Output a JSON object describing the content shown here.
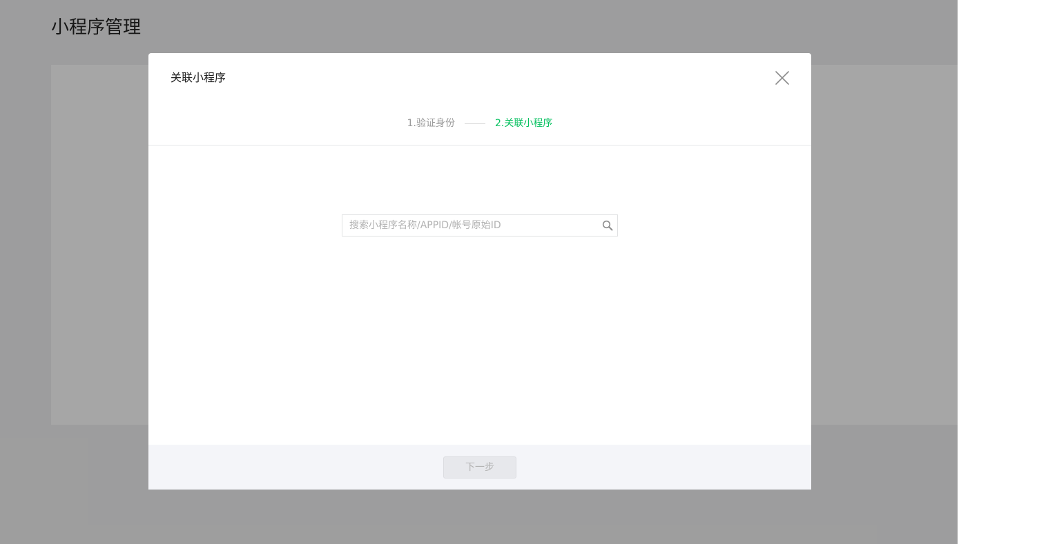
{
  "page": {
    "title": "小程序管理"
  },
  "dialog": {
    "title": "关联小程序",
    "steps": [
      {
        "label": "1.验证身份",
        "state": "done"
      },
      {
        "label": "2.关联小程序",
        "state": "active"
      }
    ],
    "search": {
      "value": "",
      "placeholder": "搜索小程序名称/APPID/帐号原始ID"
    },
    "footer": {
      "next_label": "下一步",
      "next_disabled": true
    }
  },
  "icons": {
    "close": "close-icon",
    "search": "search-icon"
  },
  "colors": {
    "accent": "#07c160",
    "mask": "rgba(0,0,0,0.35)",
    "footer_bg": "#f4f5f9"
  }
}
